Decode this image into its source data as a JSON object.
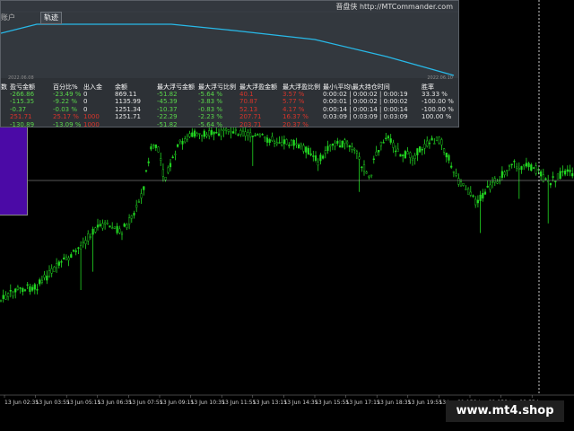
{
  "overlay": {
    "brand": "晋盘侠 http://MTCommander.com",
    "left_tab": "账户",
    "tab_label": "轨迹",
    "date_start": "2022.06.08",
    "date_end": "2022.06.10",
    "columns": [
      "数",
      "盈亏金额",
      "百分比%",
      "出入金",
      "余额",
      "最大浮亏金额",
      "最大浮亏比例",
      "最大浮盈金额",
      "最大浮盈比例",
      "最小\\平均\\最大持仓时间",
      "胜率"
    ],
    "rows": [
      [
        "",
        "-266.86",
        "-23.49 %",
        "0",
        "869.11",
        "-51.82",
        "-5.64 %",
        "40.1",
        "3.57 %",
        "0:00:02 | 0:00:02 | 0:00:19",
        "33.33 %"
      ],
      [
        "",
        "-115.35",
        "-9.22 %",
        "0",
        "1135.99",
        "-45.39",
        "-3.83 %",
        "70.87",
        "5.77 %",
        "0:00:01 | 0:00:02 | 0:00:02",
        "-100.00 %"
      ],
      [
        "",
        "-0.37",
        "-0.03 %",
        "0",
        "1251.34",
        "-10.37",
        "-0.83 %",
        "52.13",
        "4.17 %",
        "0:00:14 | 0:00:14 | 0:00:14",
        "-100.00 %"
      ],
      [
        "",
        "251.71",
        "25.17 %",
        "1000",
        "1251.71",
        "-22.29",
        "-2.23 %",
        "207.71",
        "16.37 %",
        "0:03:09 | 0:03:09 | 0:03:09",
        "100.00 %"
      ],
      [
        "",
        "-130.89",
        "-13.09 %",
        "1000",
        "",
        "-51.82",
        "-5.64 %",
        "203.71",
        "20.37 %",
        "",
        ""
      ]
    ],
    "row_colors": [
      [
        "white",
        "green",
        "green",
        "white",
        "white",
        "green",
        "green",
        "red",
        "red",
        "white",
        "white"
      ],
      [
        "white",
        "green",
        "green",
        "white",
        "white",
        "green",
        "green",
        "red",
        "red",
        "white",
        "white"
      ],
      [
        "white",
        "green",
        "green",
        "white",
        "white",
        "green",
        "green",
        "red",
        "red",
        "white",
        "white"
      ],
      [
        "white",
        "red",
        "red",
        "red",
        "white",
        "green",
        "green",
        "red",
        "red",
        "white",
        "white"
      ],
      [
        "white",
        "green",
        "green",
        "red",
        "white",
        "green",
        "green",
        "red",
        "red",
        "white",
        "white"
      ]
    ]
  },
  "chart": {
    "candle_color": "#22d822",
    "background": "#000000",
    "crosshair_color": "#b0b0b0",
    "vline_color": "#ffffff",
    "time_labels": [
      "13 Jun 02:35",
      "13 Jun 03:55",
      "13 Jun 05:15",
      "13 Jun 06:35",
      "13 Jun 07:55",
      "13 Jun 09:15",
      "13 Jun 10:35",
      "13 Jun 11:55",
      "13 Jun 13:15",
      "13 Jun 14:35",
      "13 Jun 15:55",
      "13 Jun 17:15",
      "13 Jun 18:35",
      "13 Jun 19:55",
      "13 Jun 21:15",
      "13 Jun 22:35",
      "13 Jun 23:55",
      "14"
    ]
  },
  "watermark": "www.mt4.shop"
}
